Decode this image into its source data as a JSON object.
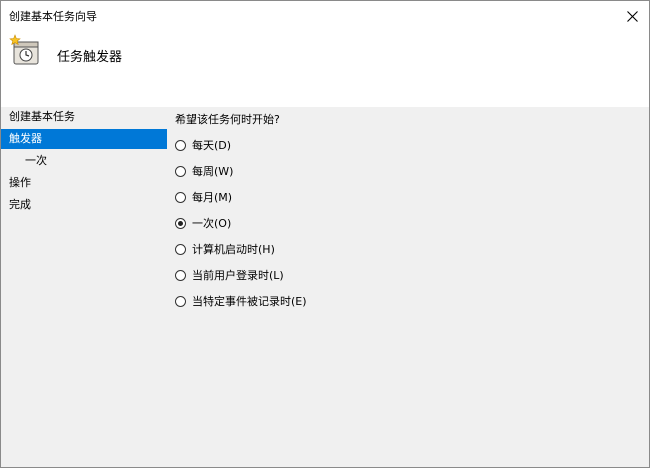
{
  "window": {
    "title": "创建基本任务向导"
  },
  "header": {
    "title": "任务触发器",
    "icon": "clock-task-icon"
  },
  "sidebar": {
    "items": [
      {
        "label": "创建基本任务",
        "active": false
      },
      {
        "label": "触发器",
        "active": true
      },
      {
        "label": "一次",
        "active": false
      },
      {
        "label": "操作",
        "active": false
      },
      {
        "label": "完成",
        "active": false
      }
    ]
  },
  "main": {
    "question": "希望该任务何时开始?",
    "options": [
      {
        "label": "每天(D)",
        "checked": false
      },
      {
        "label": "每周(W)",
        "checked": false
      },
      {
        "label": "每月(M)",
        "checked": false
      },
      {
        "label": "一次(O)",
        "checked": true
      },
      {
        "label": "计算机启动时(H)",
        "checked": false
      },
      {
        "label": "当前用户登录时(L)",
        "checked": false
      },
      {
        "label": "当特定事件被记录时(E)",
        "checked": false
      }
    ]
  },
  "colors": {
    "accent": "#0078d7",
    "panel": "#f0f0f0"
  }
}
